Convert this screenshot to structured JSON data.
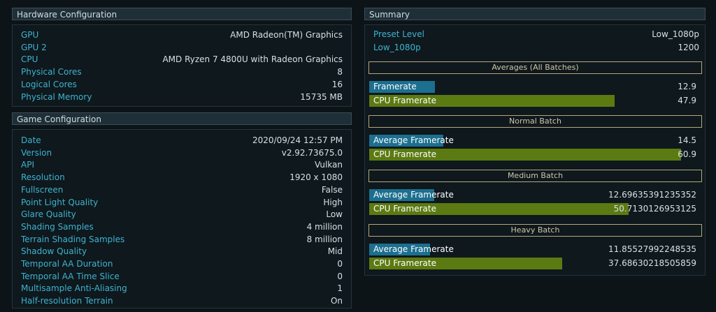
{
  "hardware": {
    "title": "Hardware Configuration",
    "rows": [
      {
        "label": "GPU",
        "value": "AMD Radeon(TM) Graphics"
      },
      {
        "label": "GPU 2",
        "value": ""
      },
      {
        "label": "CPU",
        "value": "AMD Ryzen 7 4800U with Radeon Graphics"
      },
      {
        "label": "Physical Cores",
        "value": "8"
      },
      {
        "label": "Logical Cores",
        "value": "16"
      },
      {
        "label": "Physical Memory",
        "value": "15735 MB"
      }
    ]
  },
  "game": {
    "title": "Game Configuration",
    "rows": [
      {
        "label": "Date",
        "value": "2020/09/24 12:57 PM"
      },
      {
        "label": "Version",
        "value": "v2.92.73675.0"
      },
      {
        "label": "API",
        "value": "Vulkan"
      },
      {
        "label": "Resolution",
        "value": "1920 x 1080"
      },
      {
        "label": "Fullscreen",
        "value": "False"
      },
      {
        "label": "Point Light Quality",
        "value": "High"
      },
      {
        "label": "Glare Quality",
        "value": "Low"
      },
      {
        "label": "Shading Samples",
        "value": "4 million"
      },
      {
        "label": "Terrain Shading Samples",
        "value": "8 million"
      },
      {
        "label": "Shadow Quality",
        "value": "Mid"
      },
      {
        "label": "Temporal AA Duration",
        "value": "0"
      },
      {
        "label": "Temporal AA Time Slice",
        "value": "0"
      },
      {
        "label": "Multisample Anti-Aliasing",
        "value": "1"
      },
      {
        "label": "Half-resolution Terrain",
        "value": "On"
      }
    ]
  },
  "summary": {
    "title": "Summary",
    "preset_label": "Preset Level",
    "preset_value": "Low_1080p",
    "low_label": "Low_1080p",
    "low_value": "1200",
    "scale_max": 65,
    "sections": [
      {
        "title": "Averages (All Batches)",
        "bars": [
          {
            "label": "Framerate",
            "value": "12.9",
            "amount": 12.9,
            "kind": "fr"
          },
          {
            "label": "CPU Framerate",
            "value": "47.9",
            "amount": 47.9,
            "kind": "cpu"
          }
        ]
      },
      {
        "title": "Normal Batch",
        "bars": [
          {
            "label": "Average Framerate",
            "value": "14.5",
            "amount": 14.5,
            "kind": "fr"
          },
          {
            "label": "CPU Framerate",
            "value": "60.9",
            "amount": 60.9,
            "kind": "cpu"
          }
        ]
      },
      {
        "title": "Medium Batch",
        "bars": [
          {
            "label": "Average Framerate",
            "value": "12.69635391235352",
            "amount": 12.69635391235352,
            "kind": "fr"
          },
          {
            "label": "CPU Framerate",
            "value": "50.7130126953125",
            "amount": 50.7130126953125,
            "kind": "cpu"
          }
        ]
      },
      {
        "title": "Heavy Batch",
        "bars": [
          {
            "label": "Average Framerate",
            "value": "11.85527992248535",
            "amount": 11.85527992248535,
            "kind": "fr"
          },
          {
            "label": "CPU Framerate",
            "value": "37.68630218505859",
            "amount": 37.68630218505859,
            "kind": "cpu"
          }
        ]
      }
    ]
  }
}
